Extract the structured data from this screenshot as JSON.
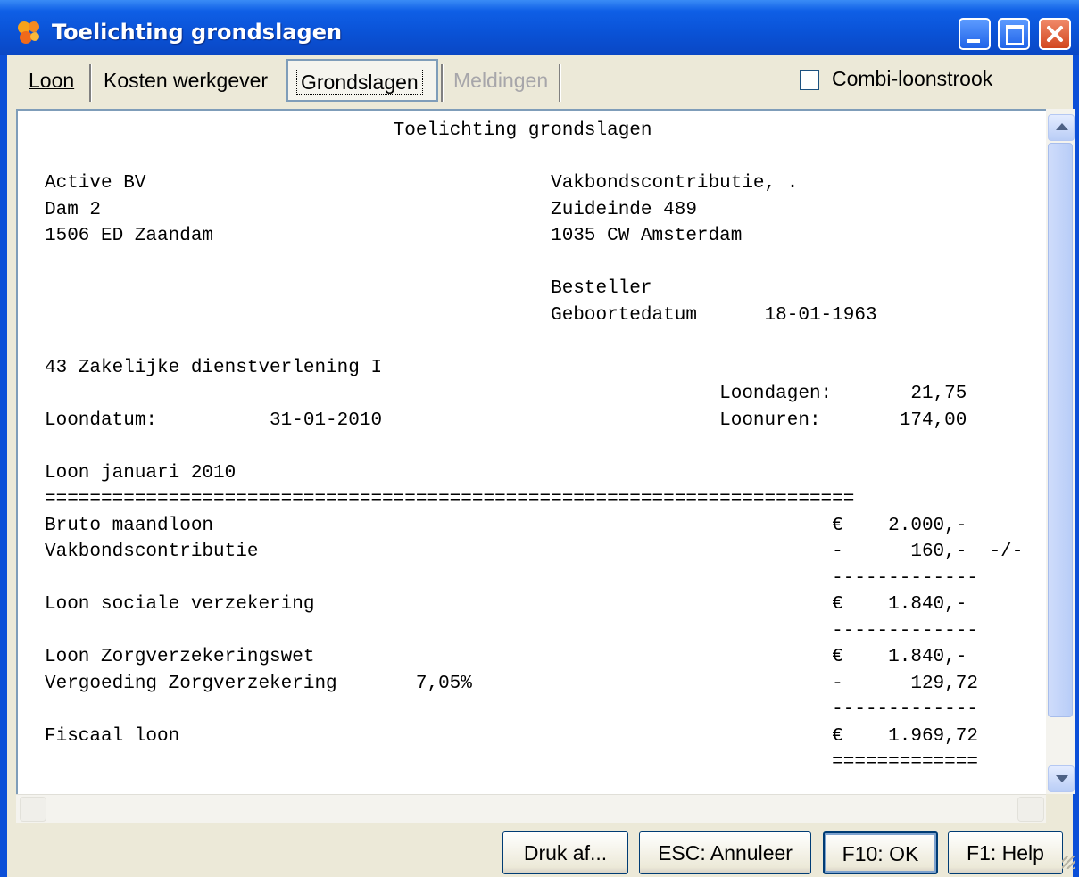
{
  "window": {
    "title": "Toelichting grondslagen"
  },
  "tabs": [
    {
      "label": "Loon"
    },
    {
      "label": "Kosten werkgever"
    },
    {
      "label": "Grondslagen"
    },
    {
      "label": "Meldingen"
    }
  ],
  "combi_checkbox": {
    "label": "Combi-loonstrook",
    "checked": false
  },
  "document": {
    "lines": [
      "                               Toelichting grondslagen",
      "",
      "Active BV                                    Vakbondscontributie, .",
      "Dam 2                                        Zuideinde 489",
      "1506 ED Zaandam                              1035 CW Amsterdam",
      "",
      "                                             Besteller",
      "                                             Geboortedatum      18-01-1963",
      "",
      "43 Zakelijke dienstverlening I",
      "                                                            Loondagen:       21,75",
      "Loondatum:          31-01-2010                              Loonuren:       174,00",
      "",
      "Loon januari 2010",
      "========================================================================",
      "Bruto maandloon                                                       €    2.000,-",
      "Vakbondscontributie                                                   -      160,-  -/-",
      "                                                                      -------------",
      "Loon sociale verzekering                                              €    1.840,-",
      "                                                                      -------------",
      "Loon Zorgverzekeringswet                                              €    1.840,-",
      "Vergoeding Zorgverzekering       7,05%                                -      129,72",
      "                                                                      -------------",
      "Fiscaal loon                                                          €    1.969,72",
      "                                                                      ============="
    ]
  },
  "buttons": {
    "print": "Druk af...",
    "cancel": "ESC: Annuleer",
    "ok": "F10: OK",
    "help": "F1: Help"
  }
}
